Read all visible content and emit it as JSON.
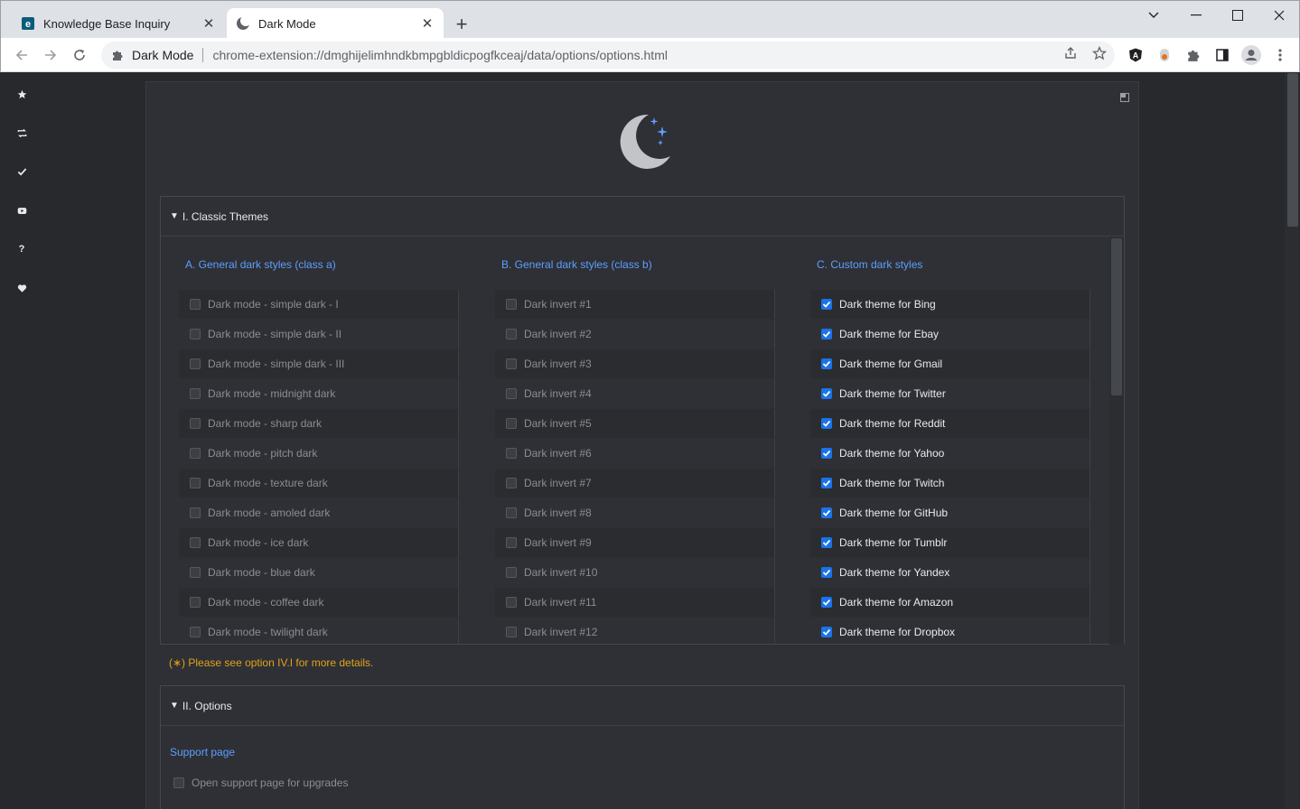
{
  "browser": {
    "tabs": [
      {
        "title": "Knowledge Base Inquiry",
        "active": false
      },
      {
        "title": "Dark Mode",
        "active": true
      }
    ],
    "omnibox": {
      "site_label": "Dark Mode",
      "url": "chrome-extension://dmghijelimhndkbmpgbldicpogfkceaj/data/options/options.html"
    }
  },
  "sidebar": {
    "items": [
      "star-icon",
      "repeat-icon",
      "check-icon",
      "youtube-icon",
      "help-icon",
      "heart-icon"
    ]
  },
  "section1": {
    "title": "I. Classic Themes",
    "columns": [
      {
        "title": "A. General dark styles (class a)",
        "items": [
          {
            "label": "Dark mode - simple dark - I",
            "checked": false
          },
          {
            "label": "Dark mode - simple dark - II",
            "checked": false
          },
          {
            "label": "Dark mode - simple dark - III",
            "checked": false
          },
          {
            "label": "Dark mode - midnight dark",
            "checked": false
          },
          {
            "label": "Dark mode - sharp dark",
            "checked": false
          },
          {
            "label": "Dark mode - pitch dark",
            "checked": false
          },
          {
            "label": "Dark mode - texture dark",
            "checked": false
          },
          {
            "label": "Dark mode - amoled dark",
            "checked": false
          },
          {
            "label": "Dark mode - ice dark",
            "checked": false
          },
          {
            "label": "Dark mode - blue dark",
            "checked": false
          },
          {
            "label": "Dark mode - coffee dark",
            "checked": false
          },
          {
            "label": "Dark mode - twilight dark",
            "checked": false
          }
        ]
      },
      {
        "title": "B. General dark styles (class b)",
        "items": [
          {
            "label": "Dark invert #1",
            "checked": false
          },
          {
            "label": "Dark invert #2",
            "checked": false
          },
          {
            "label": "Dark invert #3",
            "checked": false
          },
          {
            "label": "Dark invert #4",
            "checked": false
          },
          {
            "label": "Dark invert #5",
            "checked": false
          },
          {
            "label": "Dark invert #6",
            "checked": false
          },
          {
            "label": "Dark invert #7",
            "checked": false
          },
          {
            "label": "Dark invert #8",
            "checked": false
          },
          {
            "label": "Dark invert #9",
            "checked": false
          },
          {
            "label": "Dark invert #10",
            "checked": false
          },
          {
            "label": "Dark invert #11",
            "checked": false
          },
          {
            "label": "Dark invert #12",
            "checked": false
          }
        ]
      },
      {
        "title": "C. Custom dark styles",
        "items": [
          {
            "label": "Dark theme for Bing",
            "checked": true
          },
          {
            "label": "Dark theme for Ebay",
            "checked": true
          },
          {
            "label": "Dark theme for Gmail",
            "checked": true
          },
          {
            "label": "Dark theme for Twitter",
            "checked": true
          },
          {
            "label": "Dark theme for Reddit",
            "checked": true
          },
          {
            "label": "Dark theme for Yahoo",
            "checked": true
          },
          {
            "label": "Dark theme for Twitch",
            "checked": true
          },
          {
            "label": "Dark theme for GitHub",
            "checked": true
          },
          {
            "label": "Dark theme for Tumblr",
            "checked": true
          },
          {
            "label": "Dark theme for Yandex",
            "checked": true
          },
          {
            "label": "Dark theme for Amazon",
            "checked": true
          },
          {
            "label": "Dark theme for Dropbox",
            "checked": true
          }
        ]
      }
    ],
    "note": "(∗) Please see option IV.I for more details."
  },
  "section2": {
    "title": "II. Options",
    "support_label": "Support page",
    "option_label": "Open support page for upgrades",
    "option_checked": false
  },
  "colors": {
    "accent": "#5f9eff",
    "note": "#e3a21a",
    "checkbox_on": "#1a73e8"
  }
}
